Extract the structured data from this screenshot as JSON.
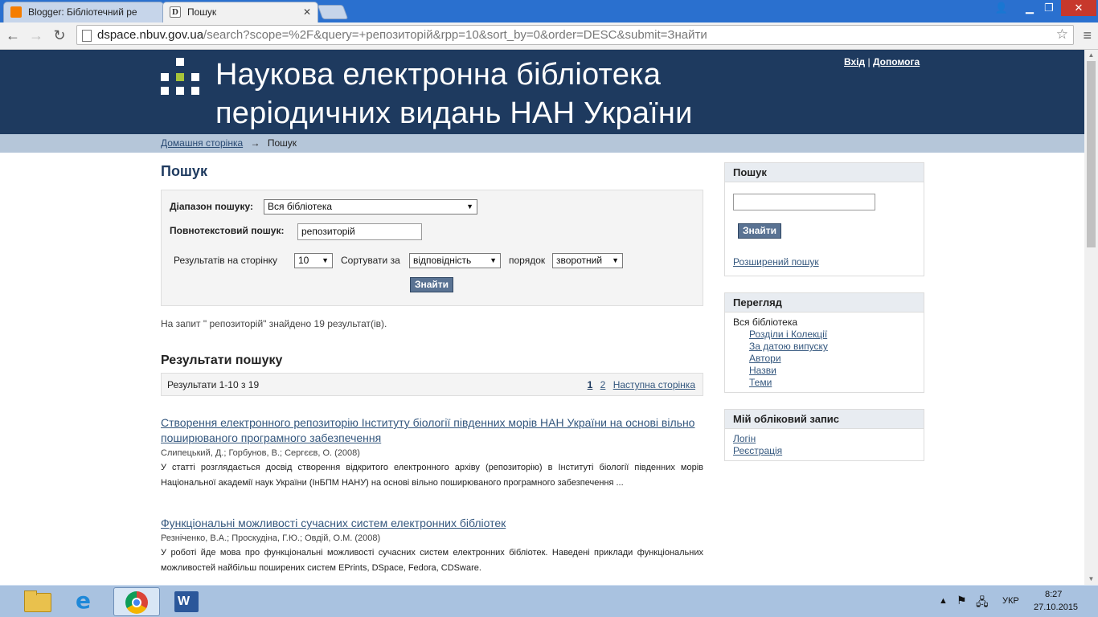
{
  "browser": {
    "tabs": [
      {
        "label": "Blogger: Бібліотечний ре",
        "active": false,
        "favicon_color": "#f57d00"
      },
      {
        "label": "Пошук",
        "active": true,
        "favicon_text": "D"
      }
    ],
    "url_host": "dspace.nbuv.gov.ua",
    "url_rest": "/search?scope=%2F&query=+репозиторій&rpp=10&sort_by=0&order=DESC&submit=Знайти"
  },
  "site": {
    "title_line1": "Наукова електронна бібліотека",
    "title_line2": "періодичних видань НАН України",
    "login": "Вхід",
    "separator": "|",
    "help": "Допомога",
    "colors": {
      "header": "#1e3a5f",
      "logo_green": "#a8c43a",
      "breadcrumb_bg": "#b5c6d9"
    }
  },
  "breadcrumb": {
    "home": "Домашня сторінка",
    "arrow": "→",
    "current": "Пошук"
  },
  "search": {
    "page_title": "Пошук",
    "scope_label": "Діапазон пошуку:",
    "scope_value": "Вся бібліотека",
    "fulltext_label": "Повнотекстовий пошук:",
    "query_value": "репозиторій",
    "rpp_label": "Результатів на сторінку",
    "rpp_value": "10",
    "sort_label": "Сортувати за",
    "sort_value": "відповідність",
    "order_label": "порядок",
    "order_value": "зворотний",
    "submit_label": "Знайти"
  },
  "summary": "На запит \" репозиторій\" знайдено 19 результат(ів).",
  "results": {
    "heading": "Результати пошуку",
    "count_text": "Результати 1-10 з 19",
    "pages": [
      "1",
      "2"
    ],
    "next_label": "Наступна сторінка",
    "items": [
      {
        "title": "Створення електронного репозиторію Інституту біології південних морів НАН України на основі вільно поширюваного програмного забезпечення",
        "authors": "Слипецький, Д.; Горбунов, В.; Сергєєв, О. (2008)",
        "abstract": "У статті розглядається досвід створення відкритого електронного архіву (репозиторію) в Інституті біології південних морів Національної академії наук України (ІнБПМ НАНУ) на основі вільно поширюваного програмного забезпечення ..."
      },
      {
        "title": "Функціональні можливості сучасних систем електронних бібліотек",
        "authors": "Резніченко, В.А.; Проскудіна, Г.Ю.; Овдій, О.М. (2008)",
        "abstract": "У роботі йде мова про функціональні можливості сучасних систем електронних бібліотек. Наведені приклади функціональних можливостей найбільш поширених систем EPrints, DSpace, Fedora, CDSware."
      }
    ]
  },
  "sidebar": {
    "search_panel": {
      "heading": "Пошук",
      "input_value": "",
      "button": "Знайти",
      "advanced": "Розширений пошук"
    },
    "browse_panel": {
      "heading": "Перегляд",
      "scope": "Вся бібліотека",
      "links": [
        "Розділи і Колекції",
        "За датою випуску",
        "Автори",
        "Назви",
        "Теми"
      ]
    },
    "account_panel": {
      "heading": "Мій обліковий запис",
      "links": [
        "Логін",
        "Реєстрація"
      ]
    }
  },
  "taskbar": {
    "lang": "УКР",
    "time": "8:27",
    "date": "27.10.2015"
  }
}
